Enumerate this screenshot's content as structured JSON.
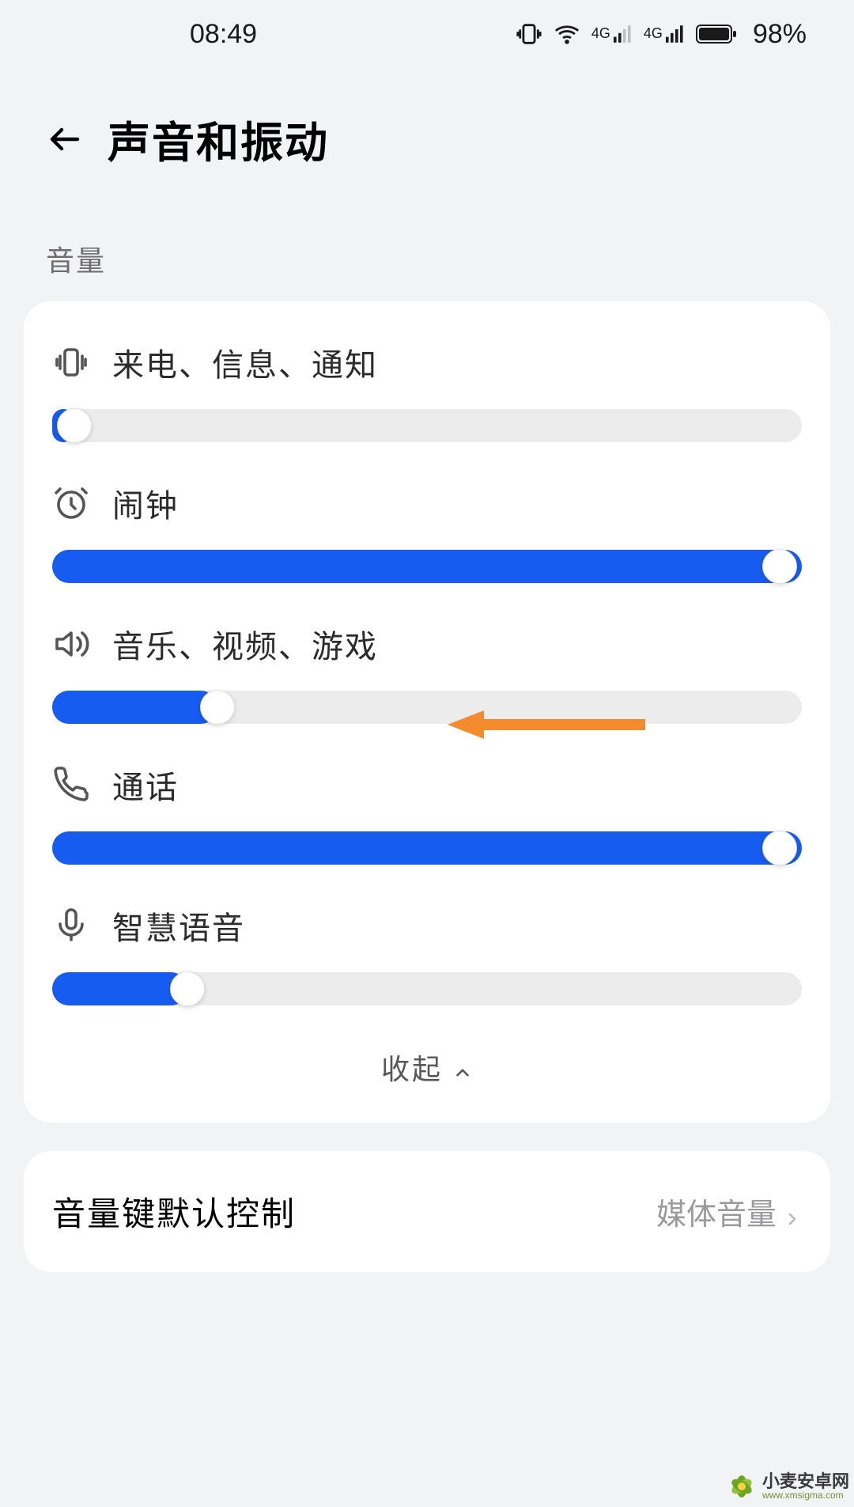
{
  "status": {
    "time": "08:49",
    "battery_percent": "98%"
  },
  "header": {
    "title": "声音和振动"
  },
  "sections": {
    "volume_label": "音量"
  },
  "volumes": {
    "ringtone": {
      "label": "来电、信息、通知",
      "value_pct": 0
    },
    "alarm": {
      "label": "闹钟",
      "value_pct": 100
    },
    "media": {
      "label": "音乐、视频、游戏",
      "value_pct": 22
    },
    "call": {
      "label": "通话",
      "value_pct": 100
    },
    "voice": {
      "label": "智慧语音",
      "value_pct": 18
    }
  },
  "collapse_label": "收起",
  "default_control": {
    "label": "音量键默认控制",
    "value": "媒体音量"
  },
  "watermark": {
    "name_cn": "小麦安卓网",
    "name_en": "www.xmsigma.com"
  },
  "colors": {
    "accent": "#175cf0",
    "annotation": "#f48b2c"
  }
}
